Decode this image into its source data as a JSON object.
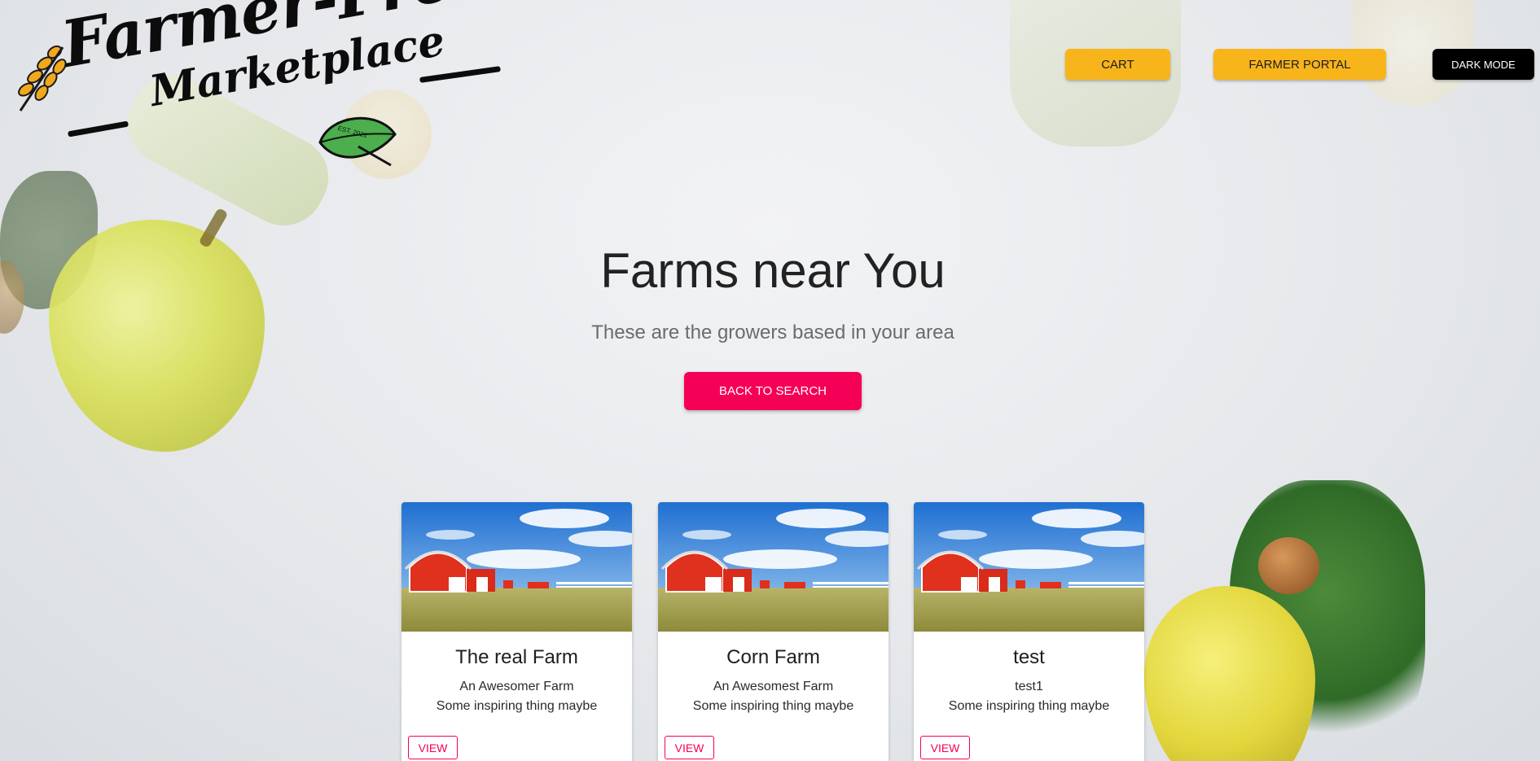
{
  "logo": {
    "line1": "Farmer-Fresh",
    "line2": "Marketplace",
    "badge": "EST. 2021"
  },
  "header": {
    "cart_label": "CART",
    "farmer_portal_label": "FARMER PORTAL",
    "dark_mode_label": "DARK MODE"
  },
  "hero": {
    "title": "Farms near You",
    "subtitle": "These are the growers based in your area",
    "back_label": "BACK TO SEARCH"
  },
  "farms": [
    {
      "name": "The real Farm",
      "description": "An Awesomer Farm",
      "tagline": "Some inspiring thing maybe",
      "view_label": "VIEW"
    },
    {
      "name": "Corn Farm",
      "description": "An Awesomest Farm",
      "tagline": "Some inspiring thing maybe",
      "view_label": "VIEW"
    },
    {
      "name": "test",
      "description": "test1",
      "tagline": "Some inspiring thing maybe",
      "view_label": "VIEW"
    }
  ],
  "colors": {
    "header_button": "#f8b41b",
    "dark_button": "#000000",
    "accent_pink": "#f50057",
    "barn_red": "#e0301e",
    "sky_blue": "#1f6fd1"
  },
  "icons": {
    "logo_wheat": "wheat-icon",
    "logo_leaf": "leaf-icon"
  }
}
